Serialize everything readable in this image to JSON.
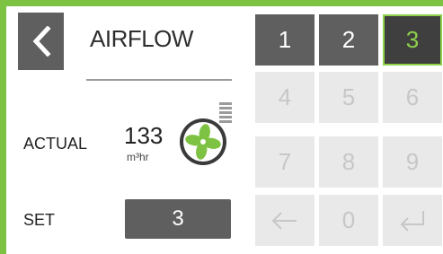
{
  "header": {
    "title": "AIRFLOW"
  },
  "actual": {
    "label": "ACTUAL",
    "value": "133",
    "unit": "m³hr"
  },
  "set": {
    "label": "SET",
    "value": "3"
  },
  "tabs": [
    {
      "label": "1",
      "selected": false
    },
    {
      "label": "2",
      "selected": false
    },
    {
      "label": "3",
      "selected": true
    }
  ],
  "keypad": {
    "keys": [
      "4",
      "5",
      "6",
      "7",
      "8",
      "9",
      "0"
    ],
    "backspace_icon": "arrow-left-icon",
    "enter_icon": "enter-icon",
    "enabled": false
  },
  "colors": {
    "accent": "#7dc242",
    "tab_bg": "#5f5f5f",
    "disabled_key": "#e9e9e9"
  }
}
